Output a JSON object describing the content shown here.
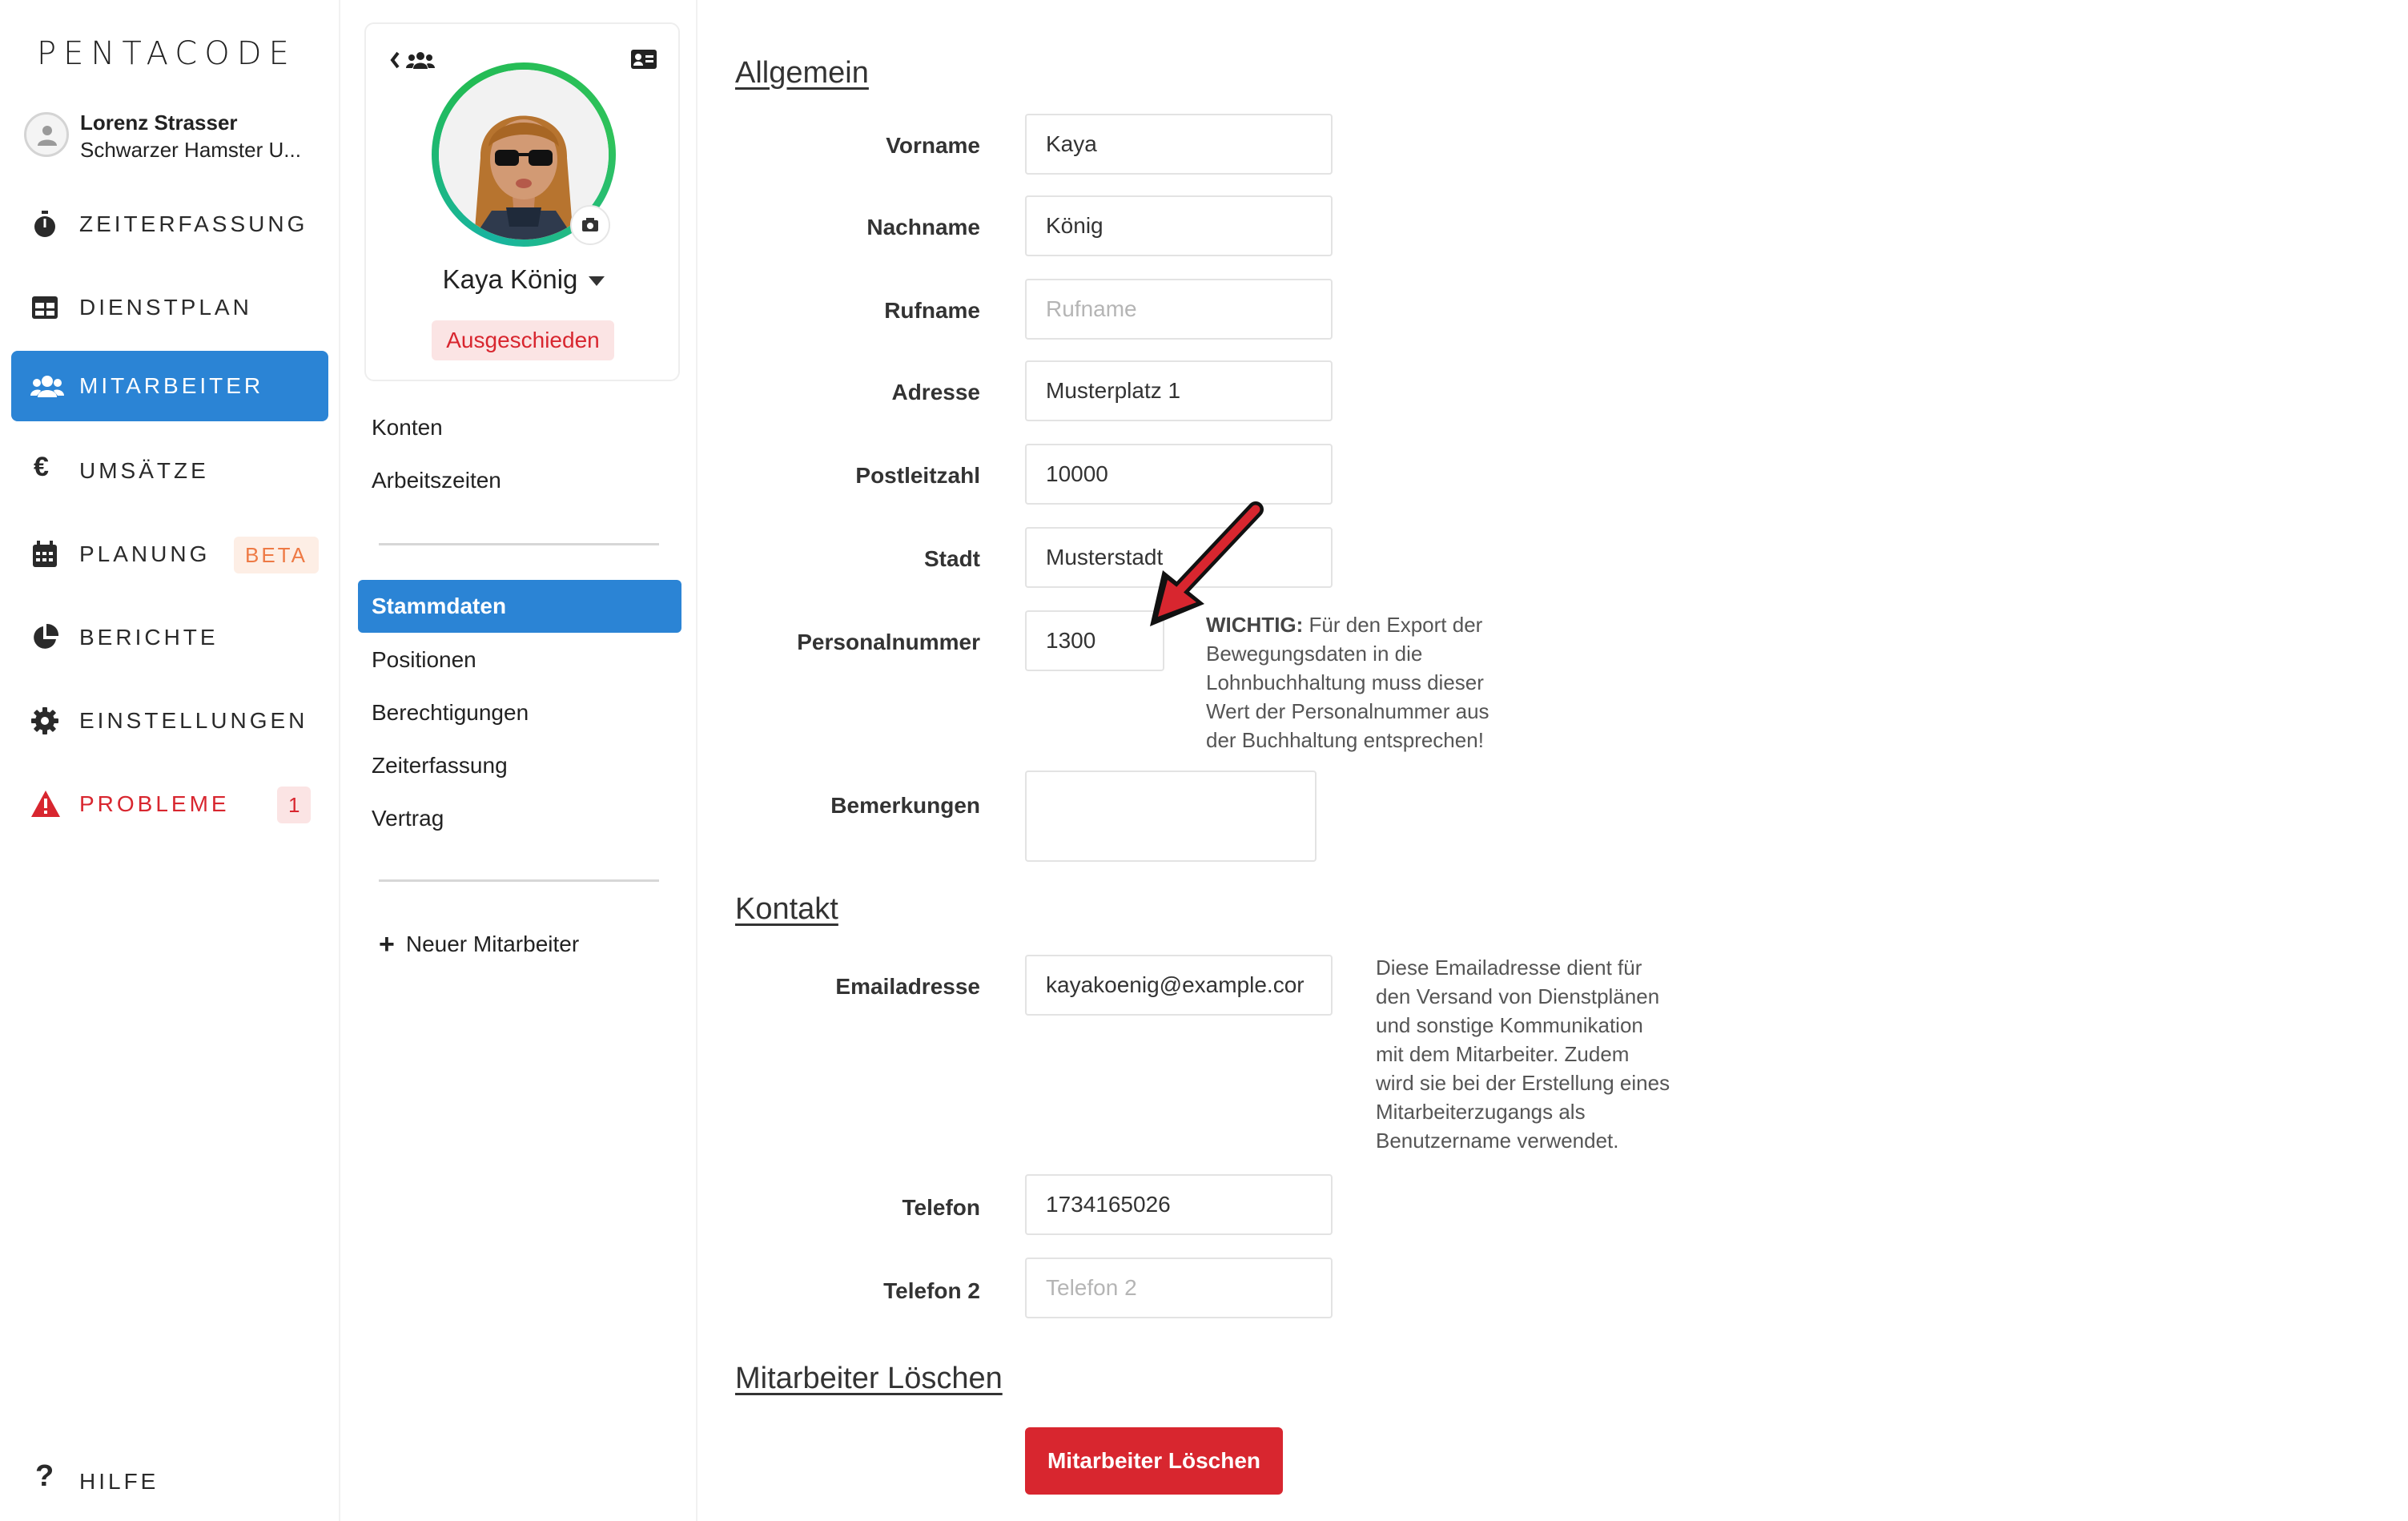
{
  "app": {
    "logo": "PENTACODE"
  },
  "user": {
    "name": "Lorenz Strasser",
    "company": "Schwarzer Hamster U..."
  },
  "nav": {
    "items": [
      {
        "label": "ZEITERFASSUNG",
        "icon": "stopwatch-icon"
      },
      {
        "label": "DIENSTPLAN",
        "icon": "table-icon"
      },
      {
        "label": "MITARBEITER",
        "icon": "users-icon",
        "active": true
      },
      {
        "label": "UMSÄTZE",
        "icon": "euro-icon"
      },
      {
        "label": "PLANUNG",
        "icon": "calendar-icon",
        "badge": "BETA"
      },
      {
        "label": "BERICHTE",
        "icon": "pie-chart-icon"
      },
      {
        "label": "EINSTELLUNGEN",
        "icon": "gear-icon"
      },
      {
        "label": "PROBLEME",
        "icon": "warning-icon",
        "badge": "1"
      }
    ],
    "help": "HILFE"
  },
  "employee": {
    "name": "Kaya König",
    "status": "Ausgeschieden"
  },
  "employee_menu": {
    "top_links": [
      "Konten",
      "Arbeitszeiten"
    ],
    "sections": [
      "Stammdaten",
      "Positionen",
      "Berechtigungen",
      "Zeiterfassung",
      "Vertrag"
    ],
    "active": "Stammdaten",
    "new_employee": "Neuer Mitarbeiter"
  },
  "form": {
    "general_title": "Allgemein",
    "fields": {
      "vorname": {
        "label": "Vorname",
        "value": "Kaya"
      },
      "nachname": {
        "label": "Nachname",
        "value": "König"
      },
      "rufname": {
        "label": "Rufname",
        "placeholder": "Rufname"
      },
      "adresse": {
        "label": "Adresse",
        "value": "Musterplatz 1"
      },
      "plz": {
        "label": "Postleitzahl",
        "value": "10000"
      },
      "stadt": {
        "label": "Stadt",
        "value": "Musterstadt"
      },
      "personalnummer": {
        "label": "Personalnummer",
        "value": "1300"
      },
      "bemerkungen": {
        "label": "Bemerkungen",
        "value": ""
      },
      "email": {
        "label": "Emailadresse",
        "value": "kayakoenig@example.cor"
      },
      "telefon": {
        "label": "Telefon",
        "value": "1734165026"
      },
      "telefon2": {
        "label": "Telefon 2",
        "placeholder": "Telefon 2"
      }
    },
    "personalnummer_note_strong": "WICHTIG:",
    "personalnummer_note_lines": [
      " Für den Export der",
      "Bewegungsdaten in die",
      "Lohnbuchhaltung muss dieser",
      "Wert der Personalnummer aus",
      "der Buchhaltung entsprechen!"
    ],
    "contact_title": "Kontakt",
    "email_note_lines": [
      "Diese Emailadresse dient für",
      "den Versand von Dienstplänen",
      "und sonstige Kommunikation",
      "mit dem Mitarbeiter. Zudem",
      "wird sie bei der Erstellung eines",
      "Mitarbeiterzugangs als",
      "Benutzername verwendet."
    ],
    "delete_title": "Mitarbeiter Löschen",
    "delete_button": "Mitarbeiter Löschen"
  },
  "colors": {
    "primary": "#2b84d5",
    "danger": "#d8262f",
    "beta_badge_bg": "#fdeee5",
    "beta_badge_text": "#ee7a45",
    "status_ring": "#22bb55"
  }
}
